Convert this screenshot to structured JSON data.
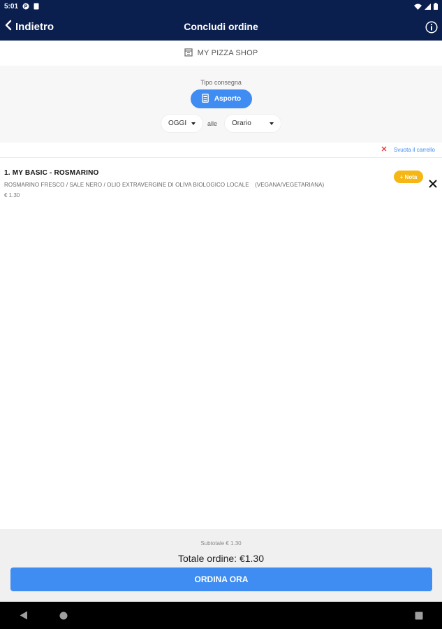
{
  "status_bar": {
    "time": "5:01"
  },
  "nav": {
    "back_label": "Indietro",
    "title": "Concludi ordine"
  },
  "shop": {
    "name": "MY PIZZA SHOP"
  },
  "delivery": {
    "label": "Tipo consegna",
    "mode_label": "Asporto",
    "day_value": "OGGI",
    "between_label": "alle",
    "time_value": "Orario"
  },
  "cart": {
    "empty_label": "Svuota il carrello",
    "items": [
      {
        "title": "1. MY BASIC - ROSMARINO",
        "description": "ROSMARINO FRESCO / SALE NERO / OLIO EXTRAVERGINE DI OLIVA BIOLOGICO LOCALE",
        "tag": "(VEGANA/VEGETARIANA)",
        "price": "€ 1.30",
        "note_label": "+ Nota"
      }
    ]
  },
  "footer": {
    "subtotal": "Subtotale € 1.30",
    "total": "Totale ordine: €1.30",
    "order_button": "ORDINA ORA"
  },
  "colors": {
    "header_bg": "#0a1f4d",
    "accent_blue": "#3f8cf2",
    "note_yellow": "#f5b616",
    "remove_red": "#e53935"
  },
  "icons": {
    "back": "chevron-left-icon",
    "info": "info-icon",
    "shop": "store-icon",
    "asporto": "bag-icon",
    "remove": "close-icon"
  }
}
